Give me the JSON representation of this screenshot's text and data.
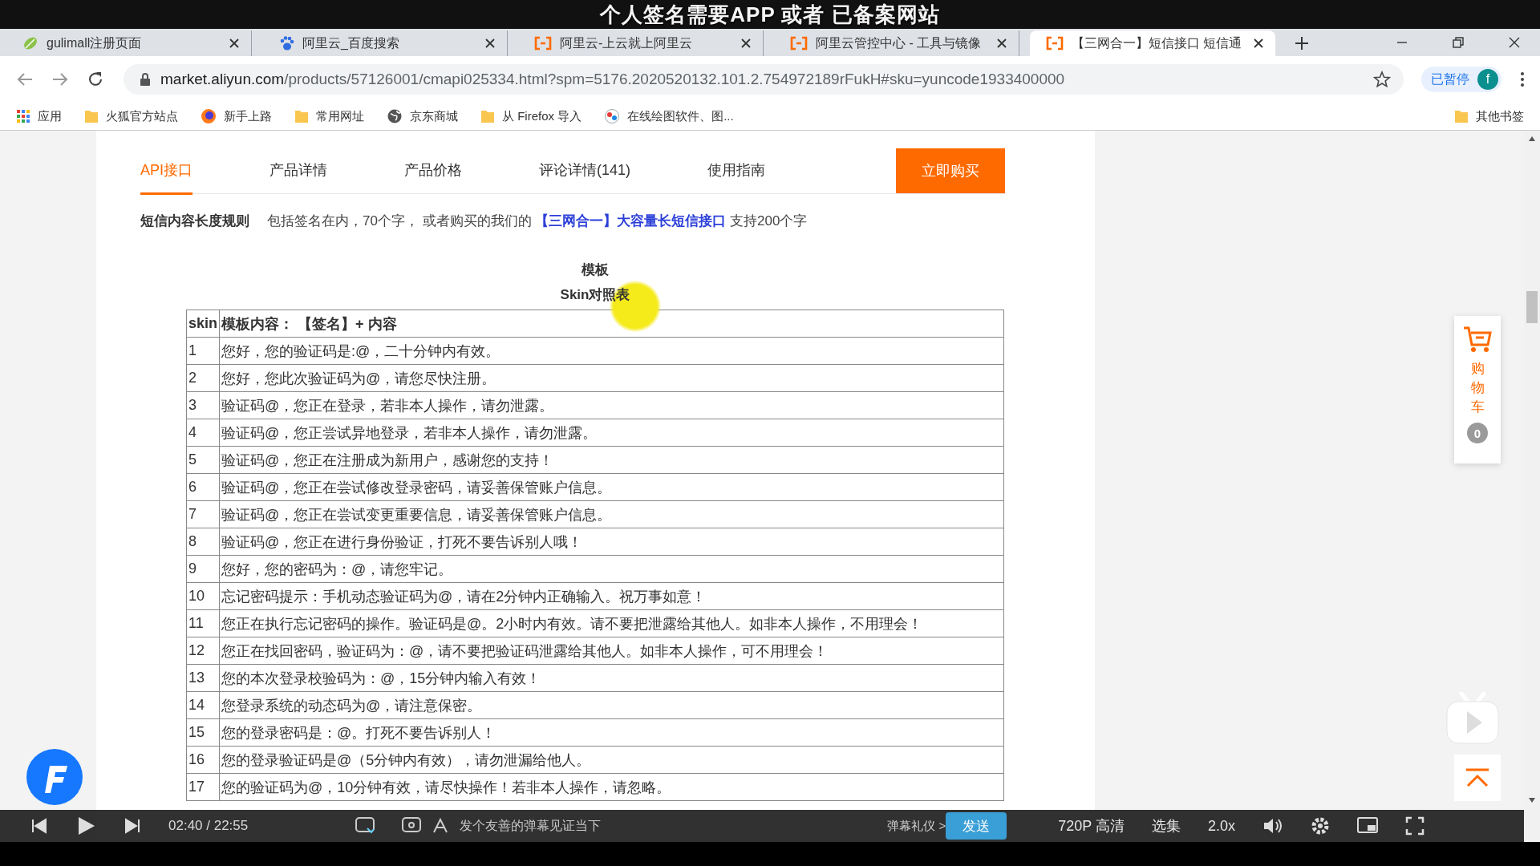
{
  "video_caption": "个人签名需要APP 或者 已备案网站",
  "browser": {
    "tabs": [
      {
        "title": "gulimall注册页面",
        "kind": "leaf",
        "selected": false
      },
      {
        "title": "阿里云_百度搜索",
        "kind": "paw",
        "selected": false
      },
      {
        "title": "阿里云-上云就上阿里云",
        "kind": "aliyun",
        "selected": false
      },
      {
        "title": "阿里云管控中心 - 工具与镜像",
        "kind": "aliyun",
        "selected": false
      },
      {
        "title": "【三网合一】短信接口 短信通",
        "kind": "aliyun",
        "selected": true
      }
    ],
    "url_host": "market.aliyun.com",
    "url_path": "/products/57126001/cmapi025334.html?spm=5176.2020520132.101.2.754972189rFukH#sku=yuncode1933400000",
    "profile": {
      "label": "已暂停",
      "avatar": "f"
    },
    "bookmarks": [
      {
        "label": "应用",
        "kind": "apps"
      },
      {
        "label": "火狐官方站点",
        "kind": "folder"
      },
      {
        "label": "新手上路",
        "kind": "firefox"
      },
      {
        "label": "常用网址",
        "kind": "folder"
      },
      {
        "label": "京东商城",
        "kind": "globe"
      },
      {
        "label": "从 Firefox 导入",
        "kind": "folder"
      },
      {
        "label": "在线绘图软件、图...",
        "kind": "drawing"
      }
    ],
    "other_bookmarks": "其他书签"
  },
  "page": {
    "nav": [
      {
        "label": "API接口",
        "selected": true
      },
      {
        "label": "产品详情",
        "selected": false
      },
      {
        "label": "产品价格",
        "selected": false
      },
      {
        "label": "评论详情(141)",
        "selected": false
      },
      {
        "label": "使用指南",
        "selected": false
      }
    ],
    "buy_button": "立即购买",
    "rule": {
      "label": "短信内容长度规则",
      "text": "包括签名在内，70个字， 或者购买的我们的",
      "link": "【三网合一】大容量长短信接口",
      "suffix": "支持200个字"
    },
    "template_title": "模板",
    "table_caption": "Skin对照表",
    "table": {
      "columns": [
        "skin",
        "模板内容： 【签名】+ 内容"
      ],
      "rows": [
        [
          "1",
          "您好，您的验证码是:@，二十分钟内有效。"
        ],
        [
          "2",
          "您好，您此次验证码为@，请您尽快注册。"
        ],
        [
          "3",
          "验证码@，您正在登录，若非本人操作，请勿泄露。"
        ],
        [
          "4",
          "验证码@，您正尝试异地登录，若非本人操作，请勿泄露。"
        ],
        [
          "5",
          "验证码@，您正在注册成为新用户，感谢您的支持！"
        ],
        [
          "6",
          "验证码@，您正在尝试修改登录密码，请妥善保管账户信息。"
        ],
        [
          "7",
          "验证码@，您正在尝试变更重要信息，请妥善保管账户信息。"
        ],
        [
          "8",
          "验证码@，您正在进行身份验证，打死不要告诉别人哦！"
        ],
        [
          "9",
          "您好，您的密码为：@，请您牢记。"
        ],
        [
          "10",
          "忘记密码提示：手机动态验证码为@，请在2分钟内正确输入。祝万事如意！"
        ],
        [
          "11",
          "您正在执行忘记密码的操作。验证码是@。2小时内有效。请不要把泄露给其他人。如非本人操作，不用理会！"
        ],
        [
          "12",
          "您正在找回密码，验证码为：@，请不要把验证码泄露给其他人。如非本人操作，可不用理会！"
        ],
        [
          "13",
          "您的本次登录校验码为：@，15分钟内输入有效！"
        ],
        [
          "14",
          "您登录系统的动态码为@，请注意保密。"
        ],
        [
          "15",
          "您的登录密码是：@。打死不要告诉别人！"
        ],
        [
          "16",
          "您的登录验证码是@（5分钟内有效），请勿泄漏给他人。"
        ],
        [
          "17",
          "您的验证码为@，10分钟有效，请尽快操作！若非本人操作，请忽略。"
        ]
      ]
    }
  },
  "cart": {
    "label": "购物车",
    "count": "0"
  },
  "player": {
    "time": "02:40 / 22:55",
    "placeholder": "发个友善的弹幕见证当下",
    "etiquette": "弹幕礼仪 >",
    "send": "发送",
    "quality": "720P 高清",
    "episodes": "选集",
    "speed": "2.0x"
  }
}
